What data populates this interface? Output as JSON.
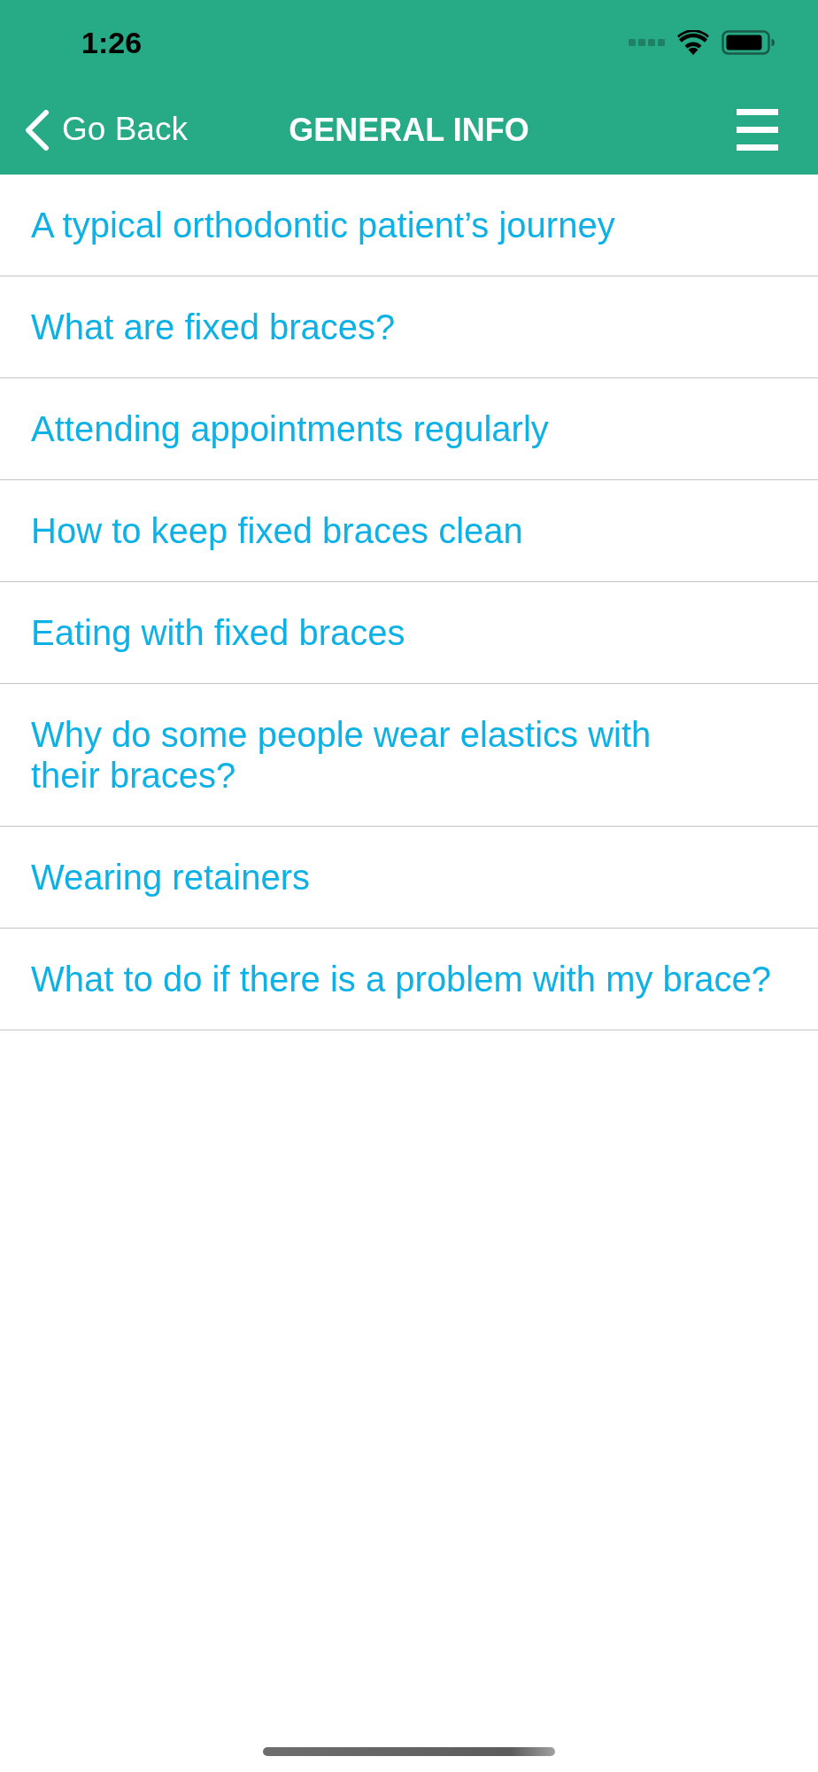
{
  "status_bar": {
    "time": "1:26"
  },
  "nav_bar": {
    "back_label": "Go Back",
    "title": "GENERAL INFO"
  },
  "topics": [
    {
      "title": "A typical orthodontic patient’s journey"
    },
    {
      "title": "What are fixed braces?"
    },
    {
      "title": "Attending appointments regularly"
    },
    {
      "title": "How to keep fixed braces clean"
    },
    {
      "title": "Eating with fixed braces"
    },
    {
      "title": "Why do some people wear elastics with\ntheir braces?"
    },
    {
      "title": "Wearing retainers"
    },
    {
      "title": "What to do if there is a problem with my brace?"
    }
  ]
}
